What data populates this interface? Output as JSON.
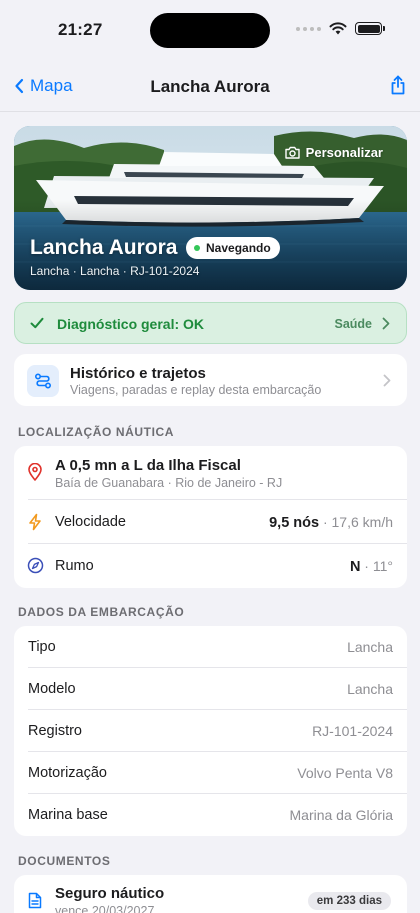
{
  "status_bar": {
    "time": "21:27"
  },
  "nav": {
    "back_label": "Mapa",
    "title": "Lancha Aurora"
  },
  "hero": {
    "personalize_label": "Personalizar",
    "name": "Lancha Aurora",
    "status_badge": "Navegando",
    "subtitle": "Lancha · Lancha · RJ-101-2024"
  },
  "diagnostic": {
    "text": "Diagnóstico geral: OK",
    "link": "Saúde"
  },
  "history": {
    "title": "Histórico e trajetos",
    "subtitle": "Viagens, paradas e replay desta embarcação"
  },
  "location_section": {
    "header": "LOCALIZAÇÃO NÁUTICA",
    "place": "A 0,5 mn a L da Ilha Fiscal",
    "place_sub": "Baía de Guanabara · Rio de Janeiro - RJ",
    "speed_label": "Velocidade",
    "speed_primary": "9,5 nós",
    "speed_secondary": " · 17,6 km/h",
    "heading_label": "Rumo",
    "heading_primary": "N",
    "heading_secondary": " · 11°"
  },
  "vessel_section": {
    "header": "DADOS DA EMBARCAÇÃO",
    "rows": [
      {
        "label": "Tipo",
        "value": "Lancha"
      },
      {
        "label": "Modelo",
        "value": "Lancha"
      },
      {
        "label": "Registro",
        "value": "RJ-101-2024"
      },
      {
        "label": "Motorização",
        "value": "Volvo Penta V8"
      },
      {
        "label": "Marina base",
        "value": "Marina da Glória"
      }
    ]
  },
  "documents_section": {
    "header": "DOCUMENTOS",
    "doc_title": "Seguro náutico",
    "doc_sub": "vence 20/03/2027",
    "doc_badge": "em 233 dias"
  },
  "colors": {
    "accent": "#0a7aff",
    "ok_green": "#1e8b3c",
    "ok_bg": "#daf0e1"
  }
}
